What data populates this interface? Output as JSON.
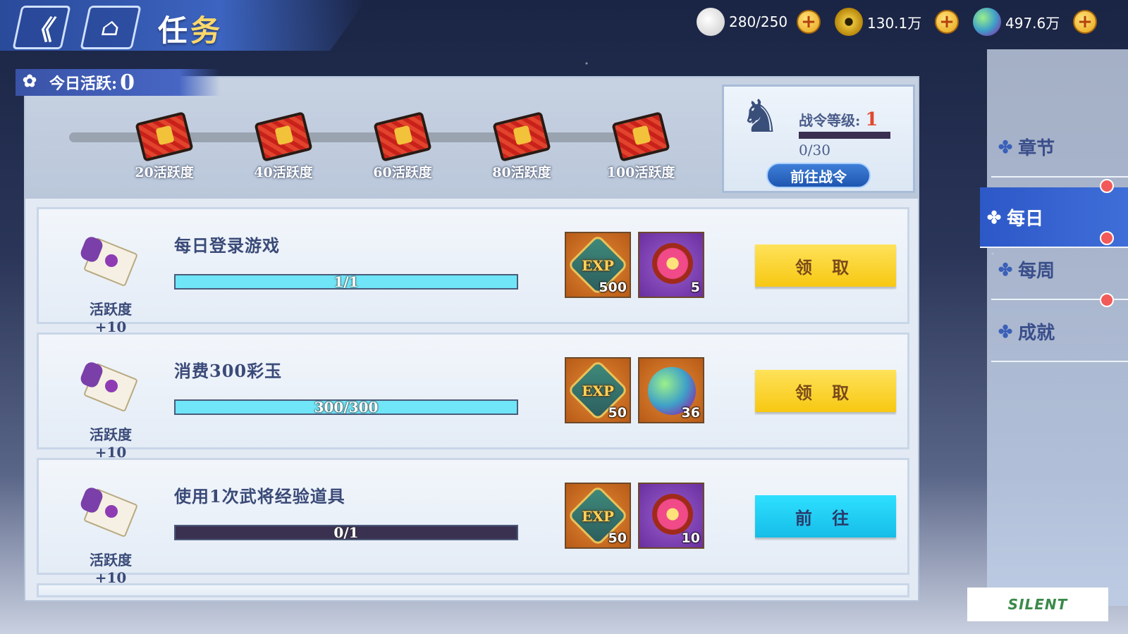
{
  "header": {
    "back_icon": "《",
    "home_icon": "⌂",
    "title_char1": "任",
    "title_char2": "务"
  },
  "currencies": [
    {
      "name": "stamina",
      "icon": "rice-ball-icon",
      "value": "280/250"
    },
    {
      "name": "coins",
      "icon": "copper-coin-icon",
      "value": "130.1万"
    },
    {
      "name": "jade",
      "icon": "jade-orb-icon",
      "value": "497.6万"
    }
  ],
  "activity": {
    "label": "今日活跃:",
    "value": "0"
  },
  "milestones": [
    {
      "label": "20活跃度"
    },
    {
      "label": "40活跃度"
    },
    {
      "label": "60活跃度"
    },
    {
      "label": "80活跃度"
    },
    {
      "label": "100活跃度"
    }
  ],
  "pass": {
    "level_label": "战令等级:",
    "level": "1",
    "progress": "0/30",
    "progress_fraction": 0,
    "button": "前往战令"
  },
  "tasks": [
    {
      "name": "每日登录游戏",
      "points": "活跃度+10",
      "progress_text": "1/1",
      "progress_fraction": 1,
      "rewards": [
        {
          "type": "exp",
          "label": "EXP",
          "count": "500"
        },
        {
          "type": "flower",
          "count": "5"
        }
      ],
      "action": "领 取",
      "action_type": "claim"
    },
    {
      "name": "消费300彩玉",
      "points": "活跃度+10",
      "progress_text": "300/300",
      "progress_fraction": 1,
      "rewards": [
        {
          "type": "exp",
          "label": "EXP",
          "count": "50"
        },
        {
          "type": "orb",
          "count": "36"
        }
      ],
      "action": "领 取",
      "action_type": "claim"
    },
    {
      "name": "使用1次武将经验道具",
      "points": "活跃度+10",
      "progress_text": "0/1",
      "progress_fraction": 0,
      "rewards": [
        {
          "type": "exp",
          "label": "EXP",
          "count": "50"
        },
        {
          "type": "flower",
          "count": "10"
        }
      ],
      "action": "前 往",
      "action_type": "go"
    }
  ],
  "side_nav": [
    {
      "label": "章节",
      "badge": false,
      "active": false
    },
    {
      "label": "每日",
      "badge": true,
      "active": true
    },
    {
      "label": "每周",
      "badge": true,
      "active": false
    },
    {
      "label": "成就",
      "badge": true,
      "active": false
    }
  ],
  "watermark": "SILENT",
  "colors": {
    "accent_blue": "#2d58c8",
    "claim_yellow": "#f7c812",
    "go_cyan": "#16bde8",
    "progress_cyan": "#6fe5f7",
    "badge_red": "#f25a5a"
  }
}
